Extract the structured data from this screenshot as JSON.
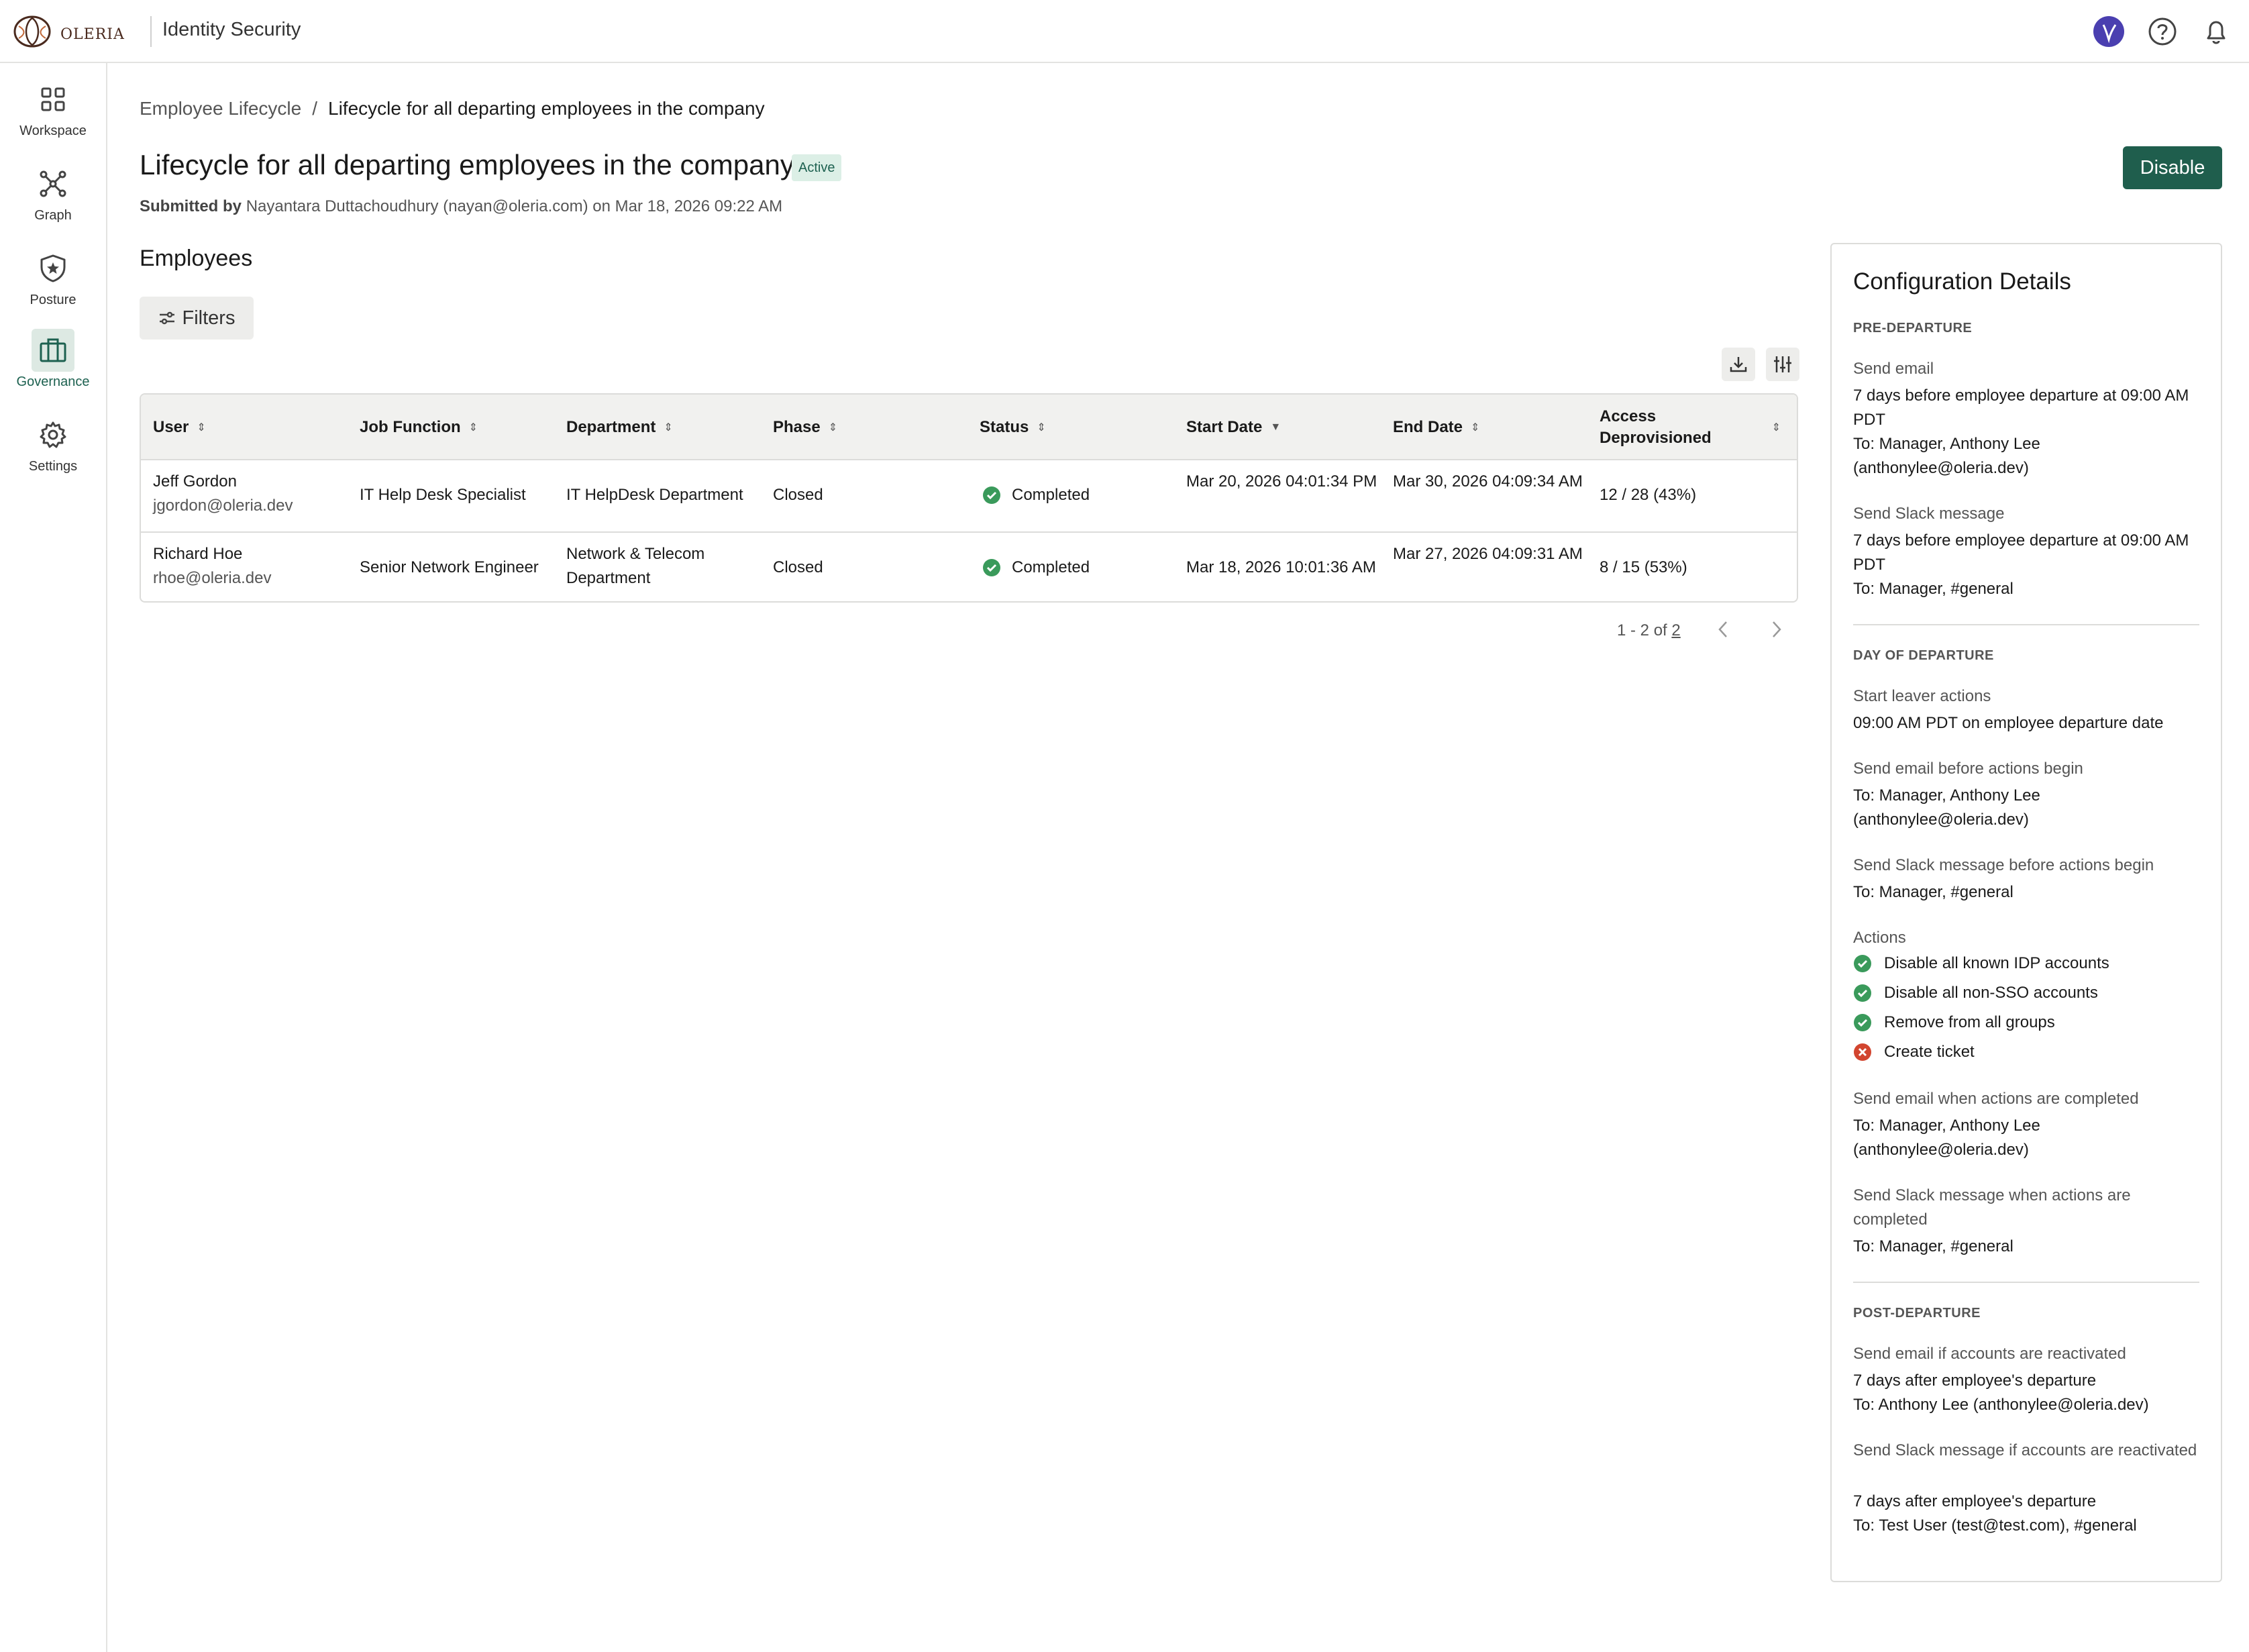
{
  "header": {
    "logo_text": "oleria",
    "product": "Identity Security"
  },
  "sidebar": {
    "items": [
      {
        "label": "Workspace",
        "icon": "grid-icon"
      },
      {
        "label": "Graph",
        "icon": "graph-icon"
      },
      {
        "label": "Posture",
        "icon": "shield-star-icon"
      },
      {
        "label": "Governance",
        "icon": "briefcase-icon",
        "active": true
      },
      {
        "label": "Settings",
        "icon": "gear-icon"
      }
    ]
  },
  "breadcrumb": {
    "parent": "Employee Lifecycle",
    "separator": "/",
    "current": "Lifecycle for all departing employees in the company"
  },
  "page": {
    "title": "Lifecycle for all departing employees in the company",
    "status_badge": "Active",
    "submitted_prefix": "Submitted by",
    "submitted_text": "Nayantara Duttachoudhury (nayan@oleria.com) on Mar 18, 2026 09:22 AM",
    "disable_label": "Disable"
  },
  "employees": {
    "heading": "Employees",
    "filters_label": "Filters",
    "columns": [
      "User",
      "Job Function",
      "Department",
      "Phase",
      "Status",
      "Start Date",
      "End Date",
      "Access Deprovisioned"
    ],
    "rows": [
      {
        "name": "Jeff Gordon",
        "email": "jgordon@oleria.dev",
        "job": "IT Help Desk Specialist",
        "department": "IT HelpDesk Department",
        "phase": "Closed",
        "status": "Completed",
        "start": "Mar 20, 2026 04:01:34 PM",
        "end": "Mar 30, 2026 04:09:34 AM",
        "access": "12 / 28 (43%)"
      },
      {
        "name": "Richard Hoe",
        "email": "rhoe@oleria.dev",
        "job": "Senior Network Engineer",
        "department": "Network & Telecom Department",
        "phase": "Closed",
        "status": "Completed",
        "start": "Mar 18, 2026 10:01:36 AM",
        "end": "Mar 27, 2026 04:09:31 AM",
        "access": "8 / 15 (53%)"
      }
    ],
    "pager_range": "1 - 2 of",
    "pager_total": "2"
  },
  "config": {
    "title": "Configuration Details",
    "pre": {
      "heading": "PRE-DEPARTURE",
      "email_label": "Send email",
      "email_when": "7 days before employee departure at 09:00 AM PDT",
      "email_to": "To: Manager, Anthony Lee (anthonylee@oleria.dev)",
      "slack_label": "Send Slack message",
      "slack_when": "7 days before employee departure at 09:00 AM PDT",
      "slack_to": "To: Manager, #general"
    },
    "day": {
      "heading": "DAY OF DEPARTURE",
      "start_label": "Start leaver actions",
      "start_val": "09:00 AM PDT on employee departure date",
      "email_before_label": "Send email before actions begin",
      "email_before_to": "To: Manager, Anthony Lee (anthonylee@oleria.dev)",
      "slack_before_label": "Send Slack message before actions begin",
      "slack_before_to": "To: Manager, #general",
      "actions_label": "Actions",
      "actions": [
        {
          "label": "Disable all known IDP accounts",
          "ok": true
        },
        {
          "label": "Disable all non-SSO accounts",
          "ok": true
        },
        {
          "label": "Remove from all groups",
          "ok": true
        },
        {
          "label": "Create ticket",
          "ok": false
        }
      ],
      "email_done_label": "Send email when actions are completed",
      "email_done_to": "To: Manager, Anthony Lee (anthonylee@oleria.dev)",
      "slack_done_label": "Send Slack message when actions are completed",
      "slack_done_to": "To: Manager, #general"
    },
    "post": {
      "heading": "POST-DEPARTURE",
      "email_label": "Send email if accounts are reactivated",
      "email_when": "7 days after employee's departure",
      "email_to": "To: Anthony Lee (anthonylee@oleria.dev)",
      "slack_label": "Send Slack message if accounts are reactivated",
      "slack_when": "7 days after employee's departure",
      "slack_to": "To: Test User (test@test.com), #general"
    }
  },
  "colors": {
    "accent": "#1f5e4d",
    "success": "#3a9a5b",
    "error": "#d2452f"
  }
}
